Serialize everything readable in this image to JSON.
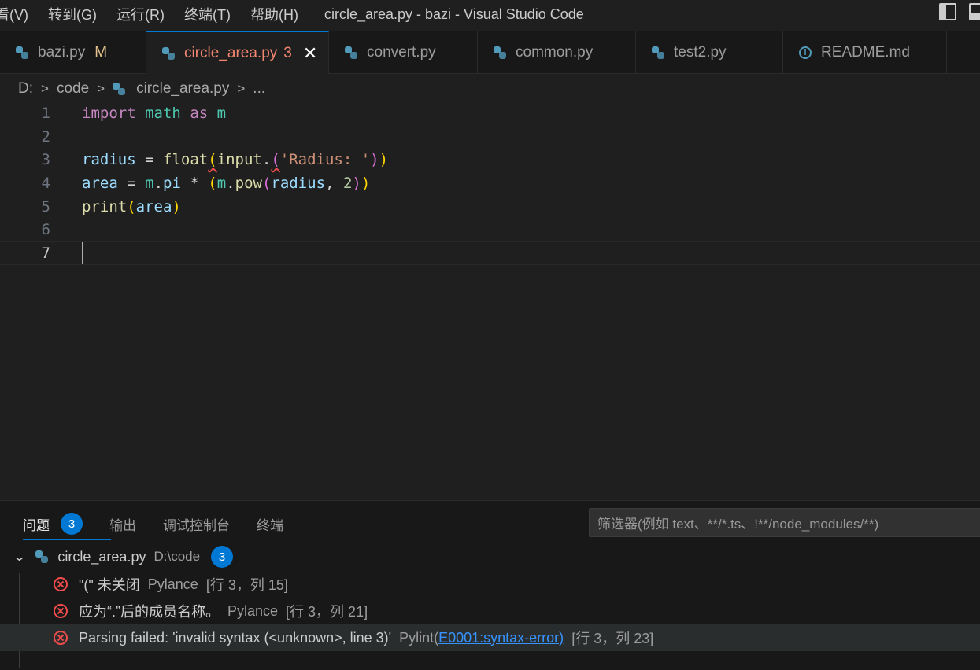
{
  "menu": [
    "看(V)",
    "转到(G)",
    "运行(R)",
    "终端(T)",
    "帮助(H)"
  ],
  "window_title": "circle_area.py - bazi - Visual Studio Code",
  "tabs": [
    {
      "label": "bazi.py",
      "badge": "M"
    },
    {
      "label": "circle_area.py",
      "badge": "3"
    },
    {
      "label": "convert.py"
    },
    {
      "label": "common.py"
    },
    {
      "label": "test2.py"
    },
    {
      "label": "README.md"
    }
  ],
  "breadcrumb": [
    "D:",
    "code",
    "circle_area.py",
    "..."
  ],
  "editor": {
    "line_numbers": [
      "1",
      "2",
      "3",
      "4",
      "5",
      "6",
      "7"
    ],
    "code": [
      "import math as m",
      "",
      "radius = float(input.('Radius: '))",
      "area = m.pi * (m.pow(radius, 2))",
      "print(area)",
      "",
      ""
    ]
  },
  "panel": {
    "tabs": [
      "问题",
      "输出",
      "调试控制台",
      "终端"
    ],
    "problem_count": "3",
    "filter_placeholder": "筛选器(例如 text、**/*.ts、!**/node_modules/**)",
    "file": {
      "name": "circle_area.py",
      "path": "D:\\code",
      "count": "3"
    },
    "problems": [
      {
        "message": "\"(\" 未关闭",
        "source": "Pylance",
        "location": "[行 3，列 15]"
      },
      {
        "message": "应为“.”后的成员名称。",
        "source": "Pylance",
        "location": "[行 3，列 21]"
      },
      {
        "message": "Parsing failed: 'invalid syntax (<unknown>, line 3)'",
        "source": "Pylint(",
        "code": "E0001:syntax-error)",
        "location": "[行 3，列 23]"
      }
    ]
  },
  "colors": {
    "accent": "#0078d4",
    "error": "#f14c4c",
    "modified": "#e2c08d"
  }
}
